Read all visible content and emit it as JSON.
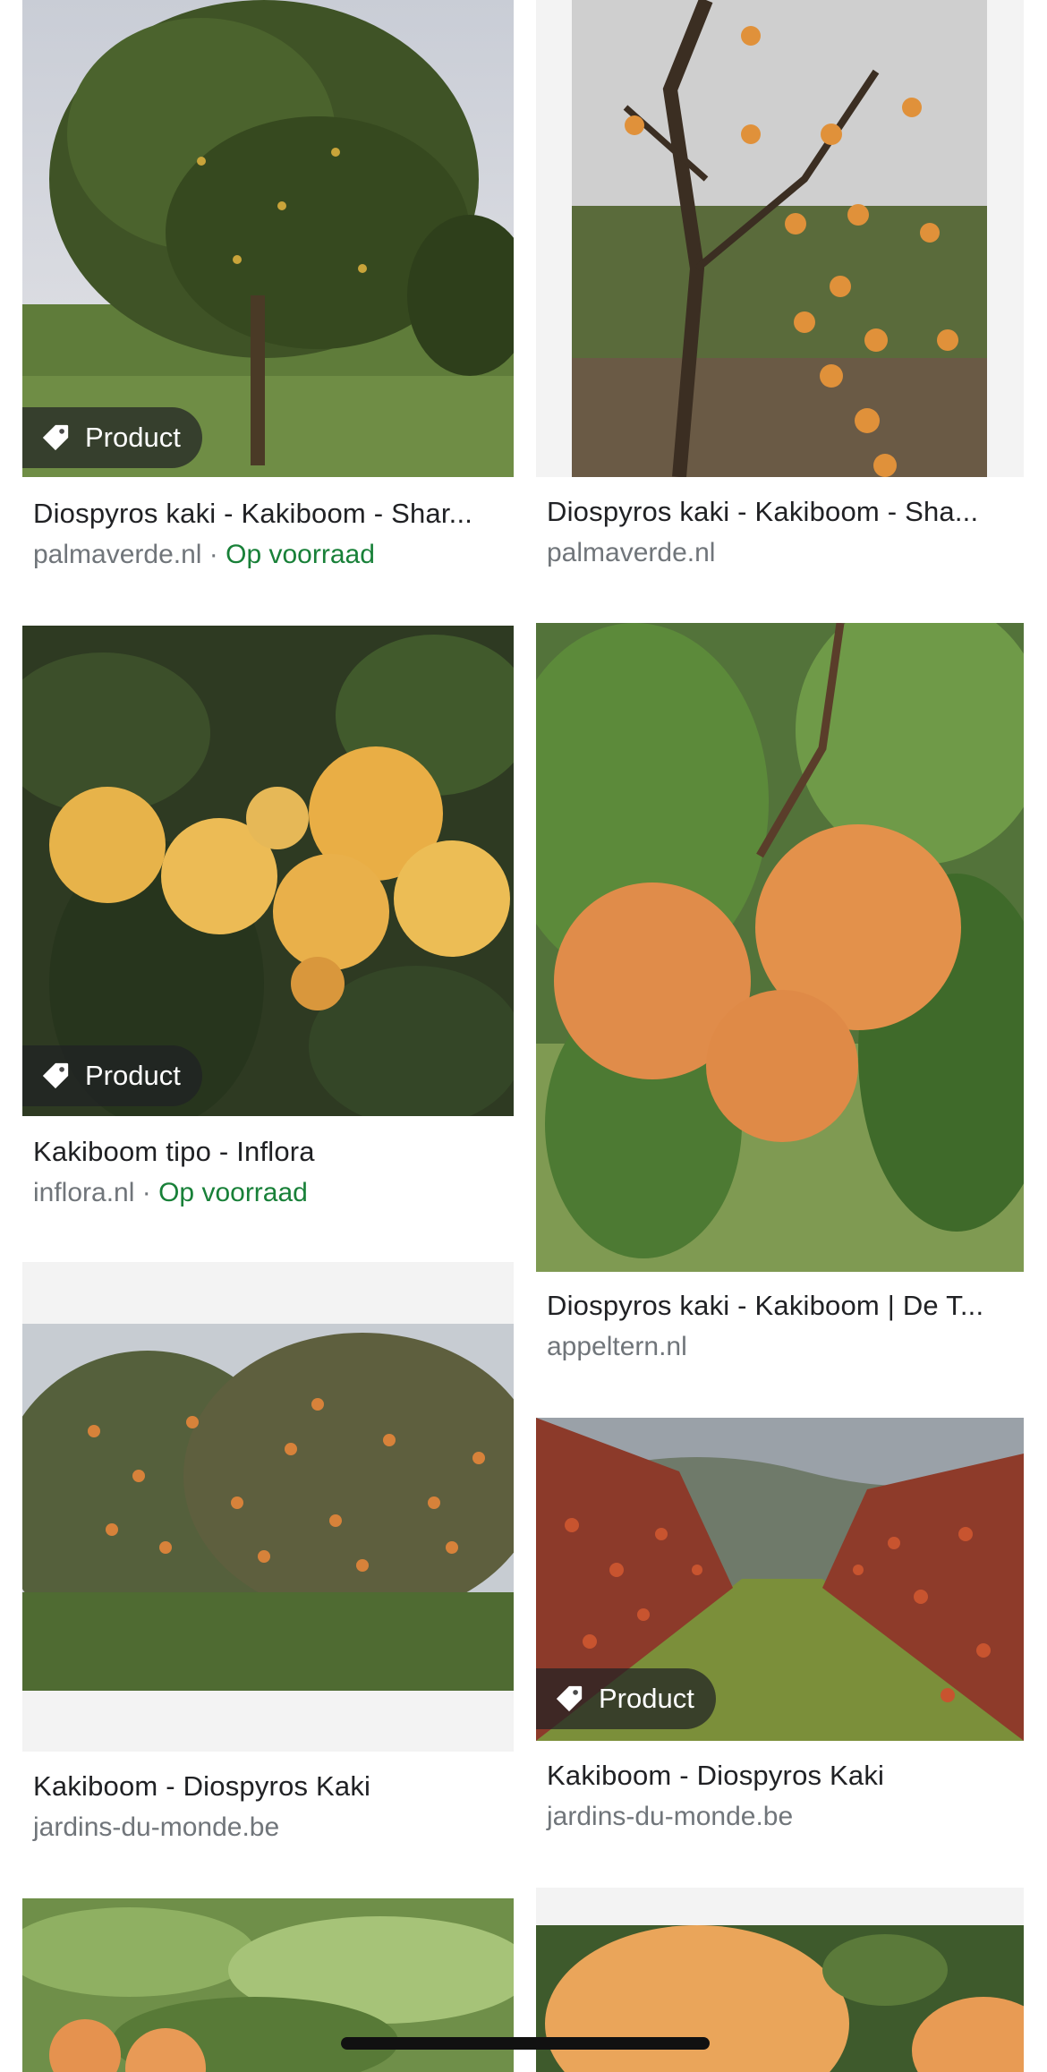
{
  "colors": {
    "title": "#202124",
    "source": "#70757a",
    "stock": "#188038",
    "badge_bg": "rgba(32,33,36,0.72)"
  },
  "badge_label": "Product",
  "separator": "·",
  "results": [
    {
      "title": "Diospyros kaki - Kakiboom - Shar...",
      "source": "palmaverde.nl",
      "stock": "Op voorraad",
      "image": "persimmon-tree-in-garden",
      "product": true
    },
    {
      "title": "Diospyros kaki - Kakiboom - Sha...",
      "source": "palmaverde.nl",
      "image": "persimmon-branches-with-orange-fruit",
      "product": false
    },
    {
      "title": "Kakiboom tipo - Inflora",
      "source": "inflora.nl",
      "stock": "Op voorraad",
      "image": "yellow-persimmons-on-branch",
      "product": true
    },
    {
      "title": "Diospyros kaki - Kakiboom | De T...",
      "source": "appeltern.nl",
      "image": "three-orange-persimmons-closeup",
      "product": false
    },
    {
      "title": "Kakiboom - Diospyros Kaki",
      "source": "jardins-du-monde.be",
      "image": "persimmon-tree-autumn",
      "product": false
    },
    {
      "title": "Kakiboom - Diospyros Kaki",
      "source": "jardins-du-monde.be",
      "image": "persimmon-orchard-rows",
      "product": true
    },
    {
      "image": "persimmons-with-leaves-partial"
    },
    {
      "image": "persimmon-fruit-closeup-partial"
    }
  ]
}
